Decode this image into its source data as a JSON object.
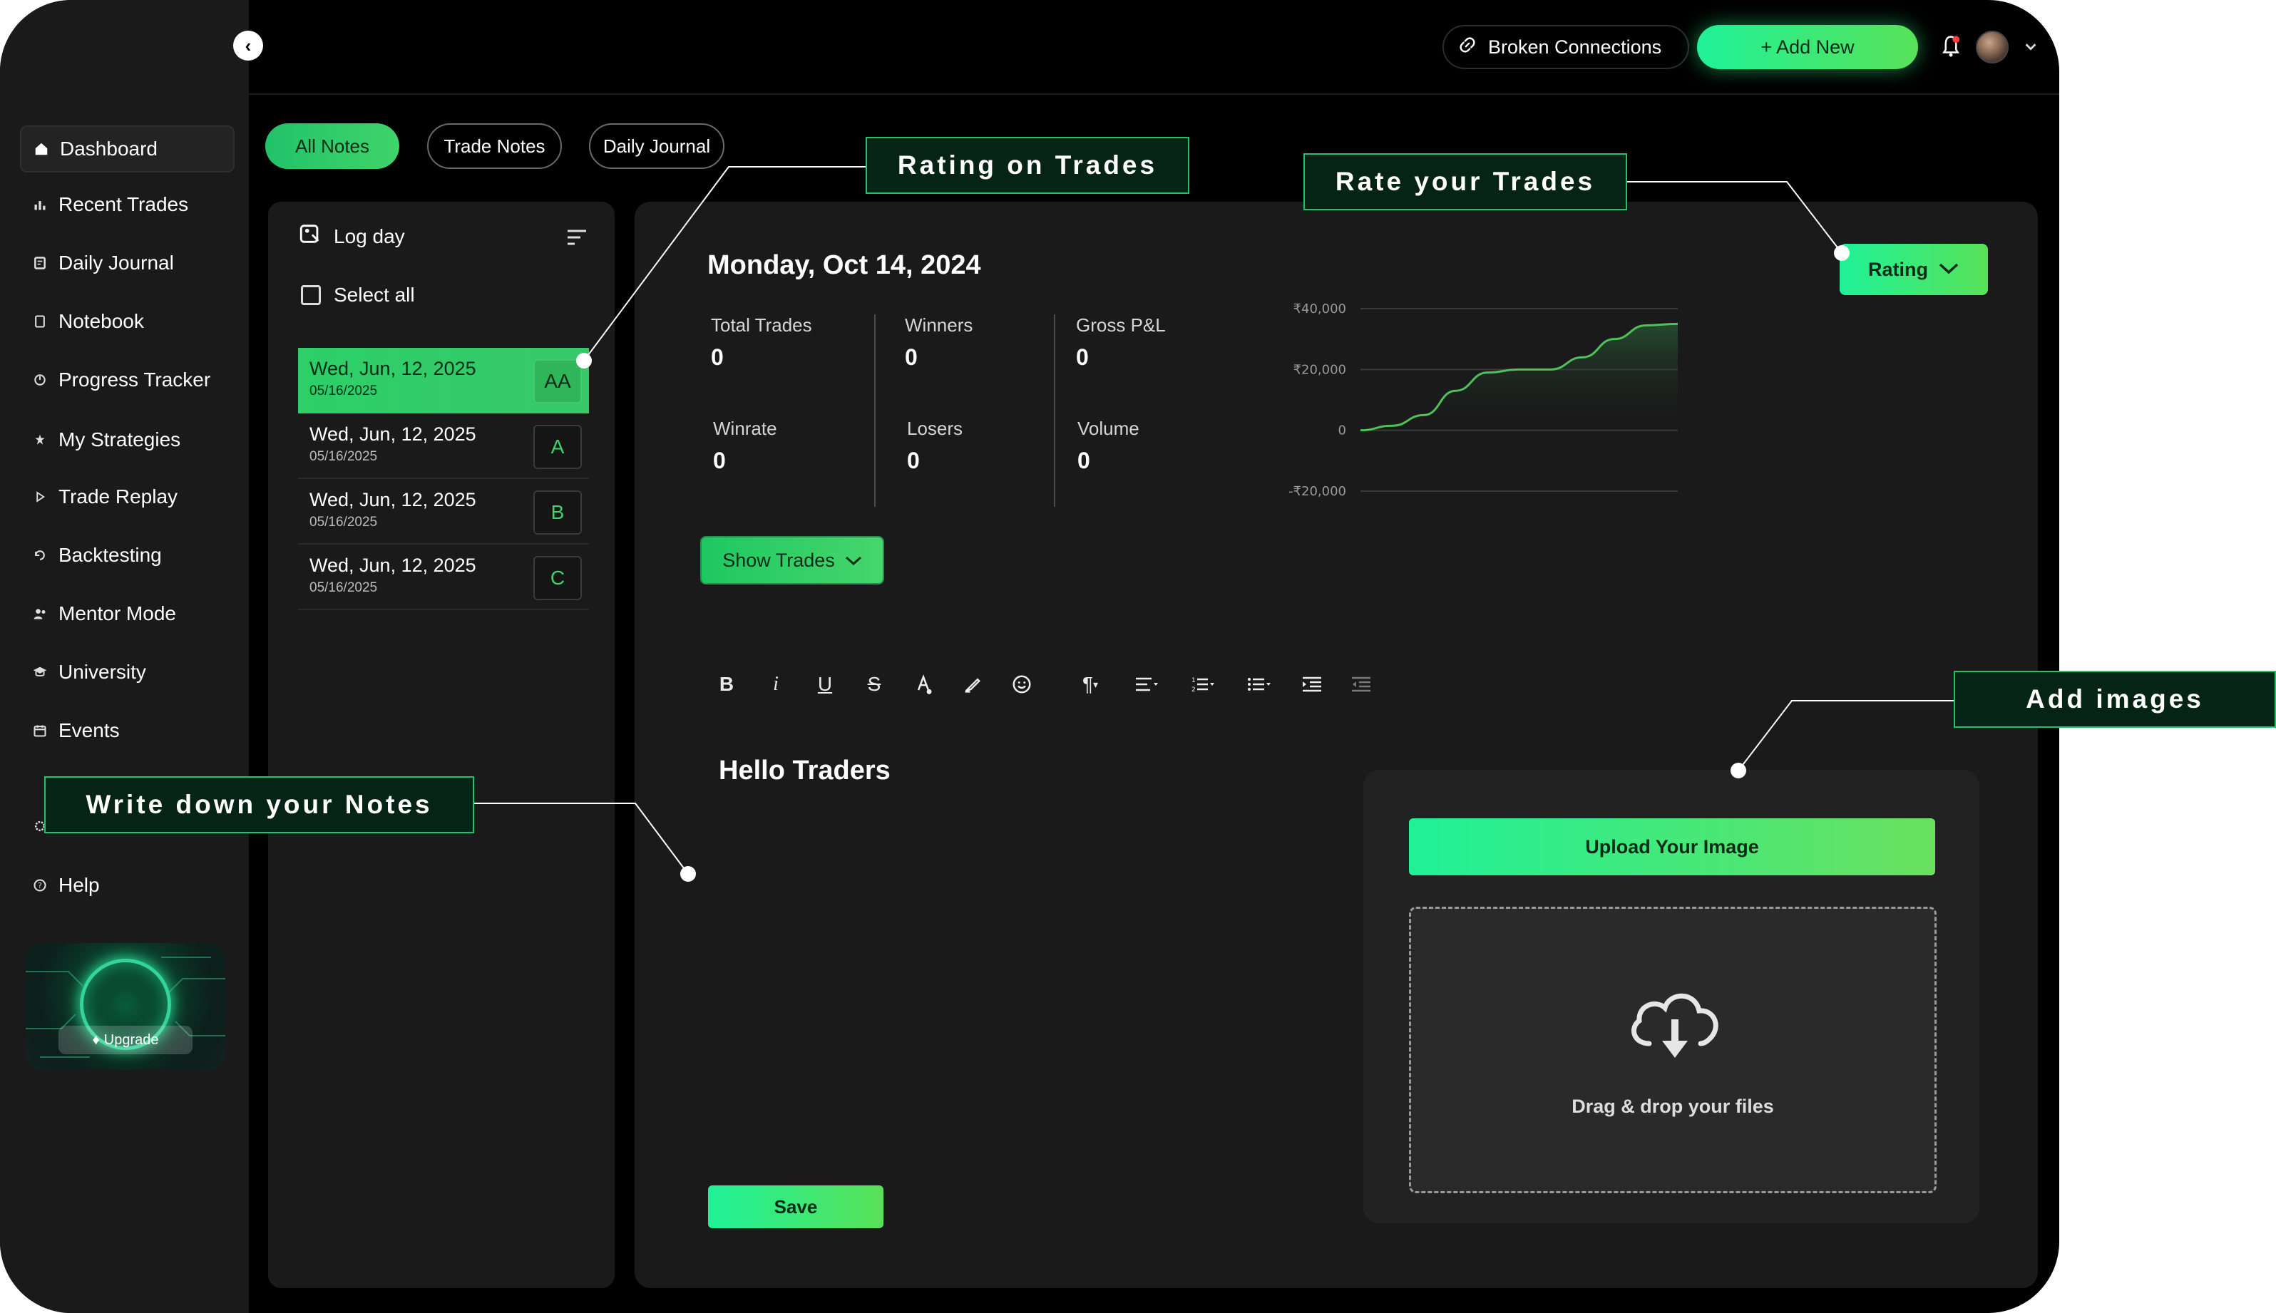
{
  "sidebar": {
    "items": [
      {
        "label": "Dashboard",
        "icon": "home-icon"
      },
      {
        "label": "Recent Trades",
        "icon": "bar-chart-icon"
      },
      {
        "label": "Daily Journal",
        "icon": "journal-icon"
      },
      {
        "label": "Notebook",
        "icon": "notebook-icon"
      },
      {
        "label": "Progress Tracker",
        "icon": "progress-icon"
      },
      {
        "label": "My Strategies",
        "icon": "strategy-icon"
      },
      {
        "label": "Trade Replay",
        "icon": "play-icon"
      },
      {
        "label": "Backtesting",
        "icon": "backtest-icon"
      },
      {
        "label": "Mentor Mode",
        "icon": "mentor-icon"
      },
      {
        "label": "University",
        "icon": "university-icon"
      },
      {
        "label": "Events",
        "icon": "events-icon"
      },
      {
        "label": "Help",
        "icon": "help-icon"
      }
    ],
    "upgrade_label": "Upgrade"
  },
  "header": {
    "broken_connections": "Broken Connections",
    "add_new": "+ Add New"
  },
  "tabs": [
    "All Notes",
    "Trade Notes",
    "Daily Journal"
  ],
  "list": {
    "title": "Log day",
    "select_all": "Select all",
    "entries": [
      {
        "date": "Wed, Jun, 12, 2025",
        "sub": "05/16/2025",
        "grade": "AA"
      },
      {
        "date": "Wed, Jun, 12, 2025",
        "sub": "05/16/2025",
        "grade": "A"
      },
      {
        "date": "Wed, Jun, 12, 2025",
        "sub": "05/16/2025",
        "grade": "B"
      },
      {
        "date": "Wed, Jun, 12, 2025",
        "sub": "05/16/2025",
        "grade": "C"
      }
    ]
  },
  "main": {
    "date_title": "Monday, Oct 14, 2024",
    "stats": [
      {
        "label": "Total Trades",
        "value": "0"
      },
      {
        "label": "Winners",
        "value": "0"
      },
      {
        "label": "Gross P&L",
        "value": "0"
      },
      {
        "label": "Winrate",
        "value": "0"
      },
      {
        "label": "Losers",
        "value": "0"
      },
      {
        "label": "Volume",
        "value": "0"
      }
    ],
    "rating_label": "Rating",
    "show_trades": "Show Trades",
    "editor_text": "Hello Traders",
    "save_label": "Save",
    "upload_label": "Upload Your Image",
    "drop_text": "Drag & drop your files"
  },
  "chart_data": {
    "type": "area",
    "yticks": [
      "₹40,000",
      "₹20,000",
      "0",
      "-₹20,000"
    ],
    "ylim": [
      -20000,
      40000
    ],
    "series": [
      {
        "values": [
          0,
          1500,
          5000,
          13000,
          19000,
          20000,
          20000,
          24000,
          30000,
          34500,
          35000
        ]
      }
    ]
  },
  "callouts": {
    "rating_on_trades": "Rating on Trades",
    "rate_your_trades": "Rate your Trades",
    "add_images": "Add images",
    "write_notes": "Write down your Notes"
  },
  "colors": {
    "accent": "#1ff197",
    "accent2": "#58e158",
    "bg": "#000000",
    "panel": "#1a1a1a"
  }
}
